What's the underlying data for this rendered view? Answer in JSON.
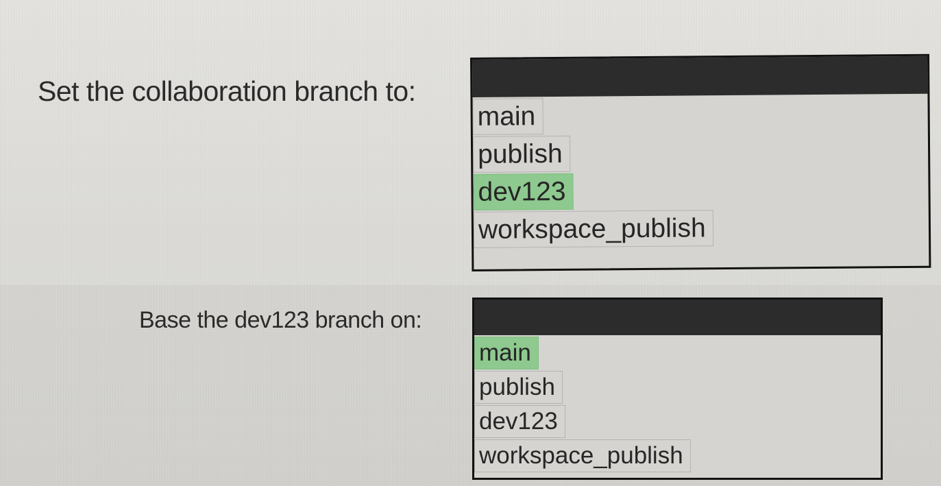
{
  "question1": {
    "prompt": "Set the collaboration branch to:",
    "options": [
      "main",
      "publish",
      "dev123",
      "workspace_publish"
    ],
    "selected": "dev123"
  },
  "question2": {
    "prompt": "Base the dev123 branch on:",
    "options": [
      "main",
      "publish",
      "dev123",
      "workspace_publish"
    ],
    "selected": "main"
  },
  "colors": {
    "selected_highlight": "#8ec98f",
    "dropdown_header": "#2c2c2c",
    "dropdown_border": "#121212",
    "background": "#dcdbd7"
  }
}
